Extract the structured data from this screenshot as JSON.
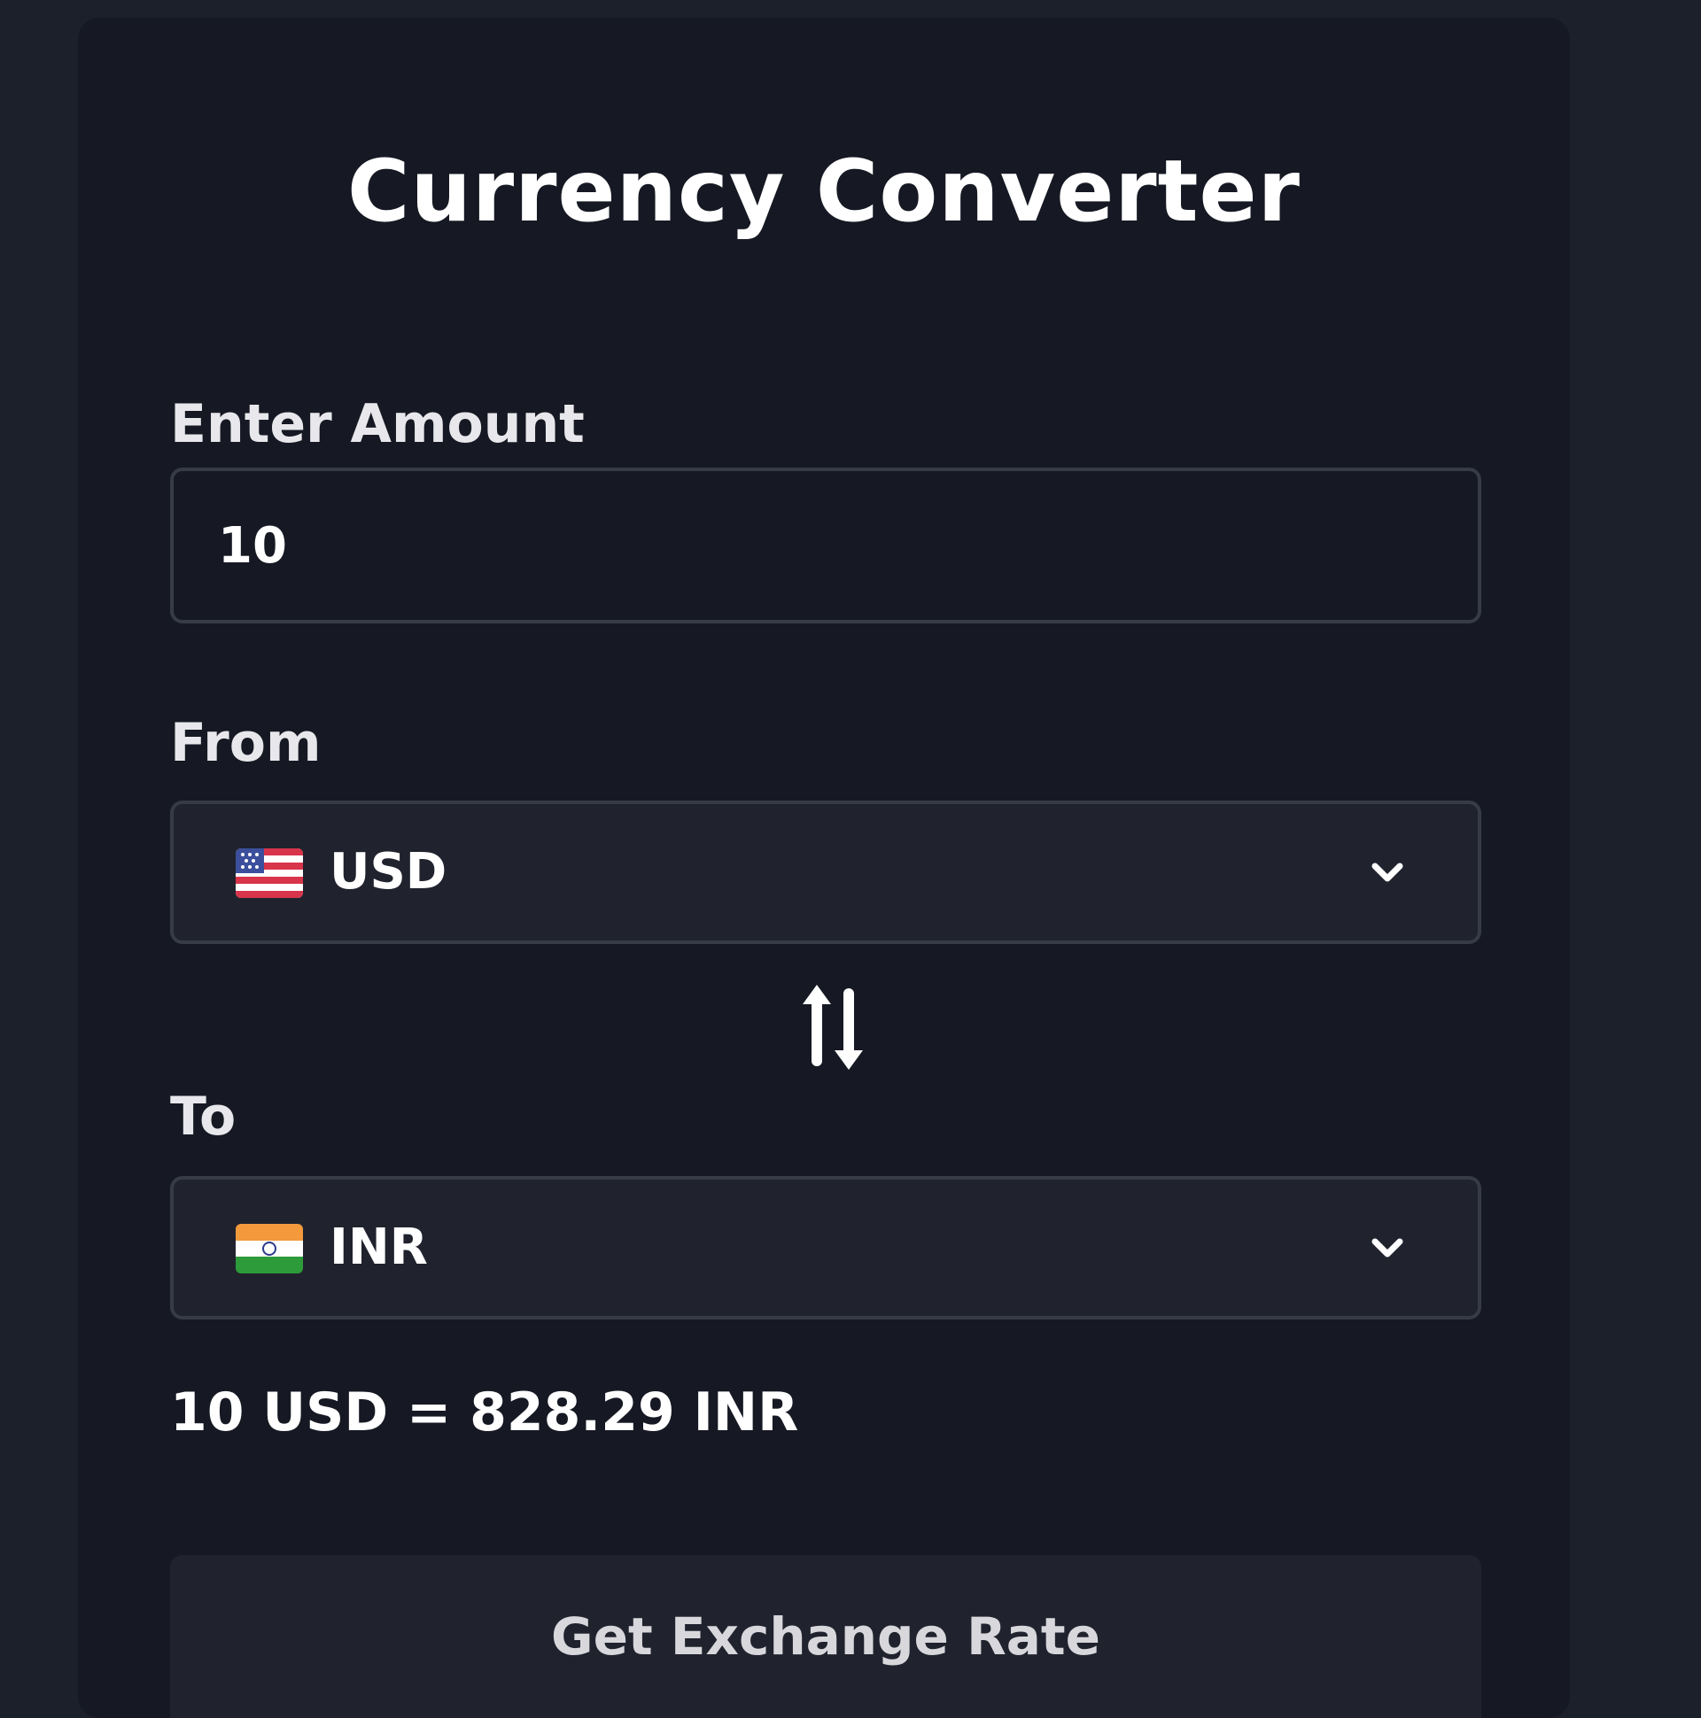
{
  "title": "Currency Converter",
  "amount": {
    "label": "Enter Amount",
    "value": "10"
  },
  "from": {
    "label": "From",
    "currency": "USD",
    "flag_icon": "us-flag-icon"
  },
  "to": {
    "label": "To",
    "currency": "INR",
    "flag_icon": "india-flag-icon"
  },
  "swap_icon": "swap-arrows-icon",
  "result": "10 USD = 828.29 INR",
  "button": {
    "label": "Get Exchange Rate"
  },
  "colors": {
    "page_background": "#1b202b",
    "card_background": "#161923",
    "field_background": "#20232e",
    "border": "#363b47",
    "text": "#ffffff"
  }
}
